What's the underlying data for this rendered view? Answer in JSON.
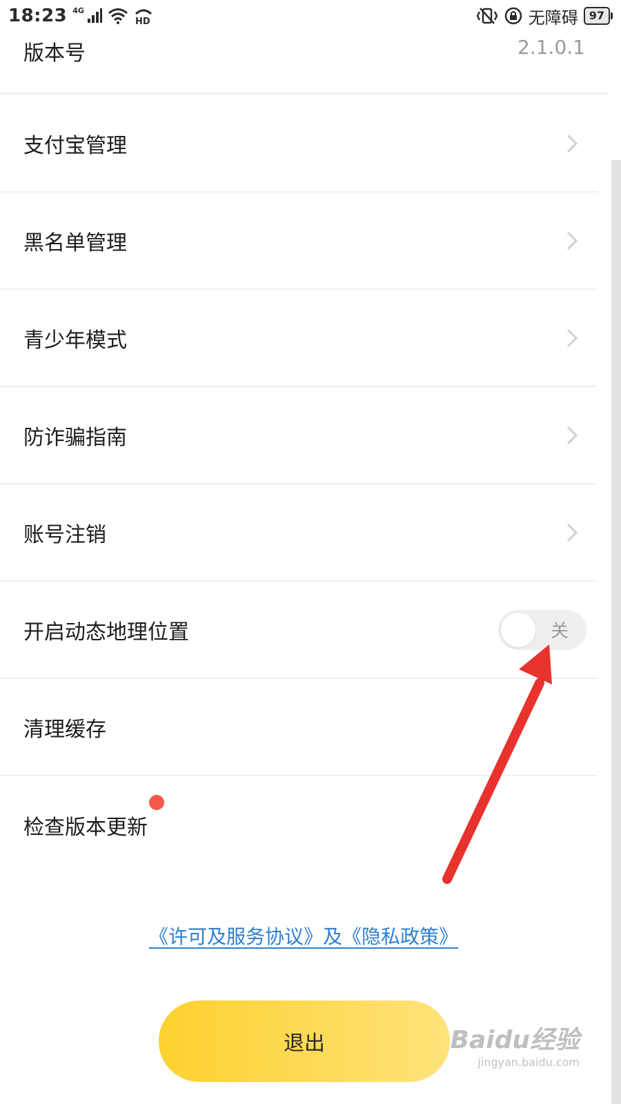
{
  "status_bar": {
    "time": "18:23",
    "network_type": "4G",
    "accessibility_label": "无障碍",
    "battery": "97",
    "icons": [
      "signal-icon",
      "wifi-icon",
      "hd-icon",
      "vibrate-icon",
      "lock-rotation-icon",
      "battery-icon"
    ]
  },
  "version": {
    "label": "版本号",
    "value": "2.1.0.1"
  },
  "settings": [
    {
      "label": "支付宝管理",
      "control": "chevron"
    },
    {
      "label": "黑名单管理",
      "control": "chevron"
    },
    {
      "label": "青少年模式",
      "control": "chevron"
    },
    {
      "label": "防诈骗指南",
      "control": "chevron"
    },
    {
      "label": "账号注销",
      "control": "chevron"
    },
    {
      "label": "开启动态地理位置",
      "control": "toggle",
      "toggle_state": "关"
    },
    {
      "label": "清理缓存",
      "control": "none"
    },
    {
      "label": "检查版本更新",
      "control": "none",
      "badge": "red-dot"
    }
  ],
  "agreement": {
    "text": "《许可及服务协议》及《隐私政策》"
  },
  "logout": {
    "label": "退出"
  },
  "watermark": {
    "main": "Baidu经验",
    "sub": "jingyan.baidu.com"
  },
  "colors": {
    "accent_yellow_start": "#fdd12f",
    "accent_yellow_end": "#fee37a",
    "link_blue": "#2d7fd0",
    "annotation_red": "#e8322d",
    "badge_red": "#f5594a",
    "secondary_text": "#9a9a9a"
  }
}
